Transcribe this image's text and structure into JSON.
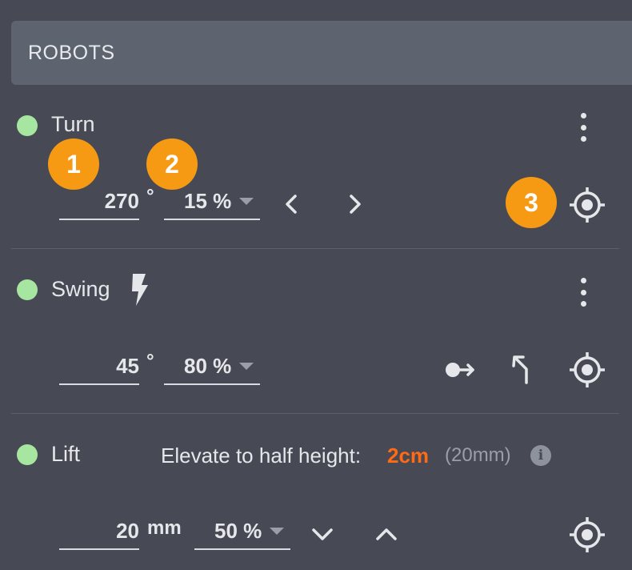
{
  "panel": {
    "title": "ROBOTS"
  },
  "accent_color": "#f59a12",
  "status_color": "#a6e6a0",
  "highlight_color": "#ff6a13",
  "callouts": [
    "1",
    "2",
    "3"
  ],
  "turn": {
    "name": "Turn",
    "angle": "270",
    "angle_unit": "°",
    "speed": "15 %",
    "icons": [
      "chevron-left-icon",
      "chevron-right-icon",
      "target-icon"
    ]
  },
  "swing": {
    "name": "Swing",
    "angle": "45",
    "angle_unit": "°",
    "speed": "80 %",
    "icons": [
      "lightning-icon",
      "pivot-arrow-icon",
      "turn-arrow-icon",
      "target-icon"
    ]
  },
  "lift": {
    "name": "Lift",
    "hint_label": "Elevate to half height:",
    "hint_value": "2cm",
    "hint_sub": "(20mm)",
    "distance": "20",
    "distance_unit": "mm",
    "speed": "50 %",
    "icons": [
      "info-icon",
      "chevron-down-icon",
      "chevron-up-icon",
      "target-icon"
    ]
  }
}
